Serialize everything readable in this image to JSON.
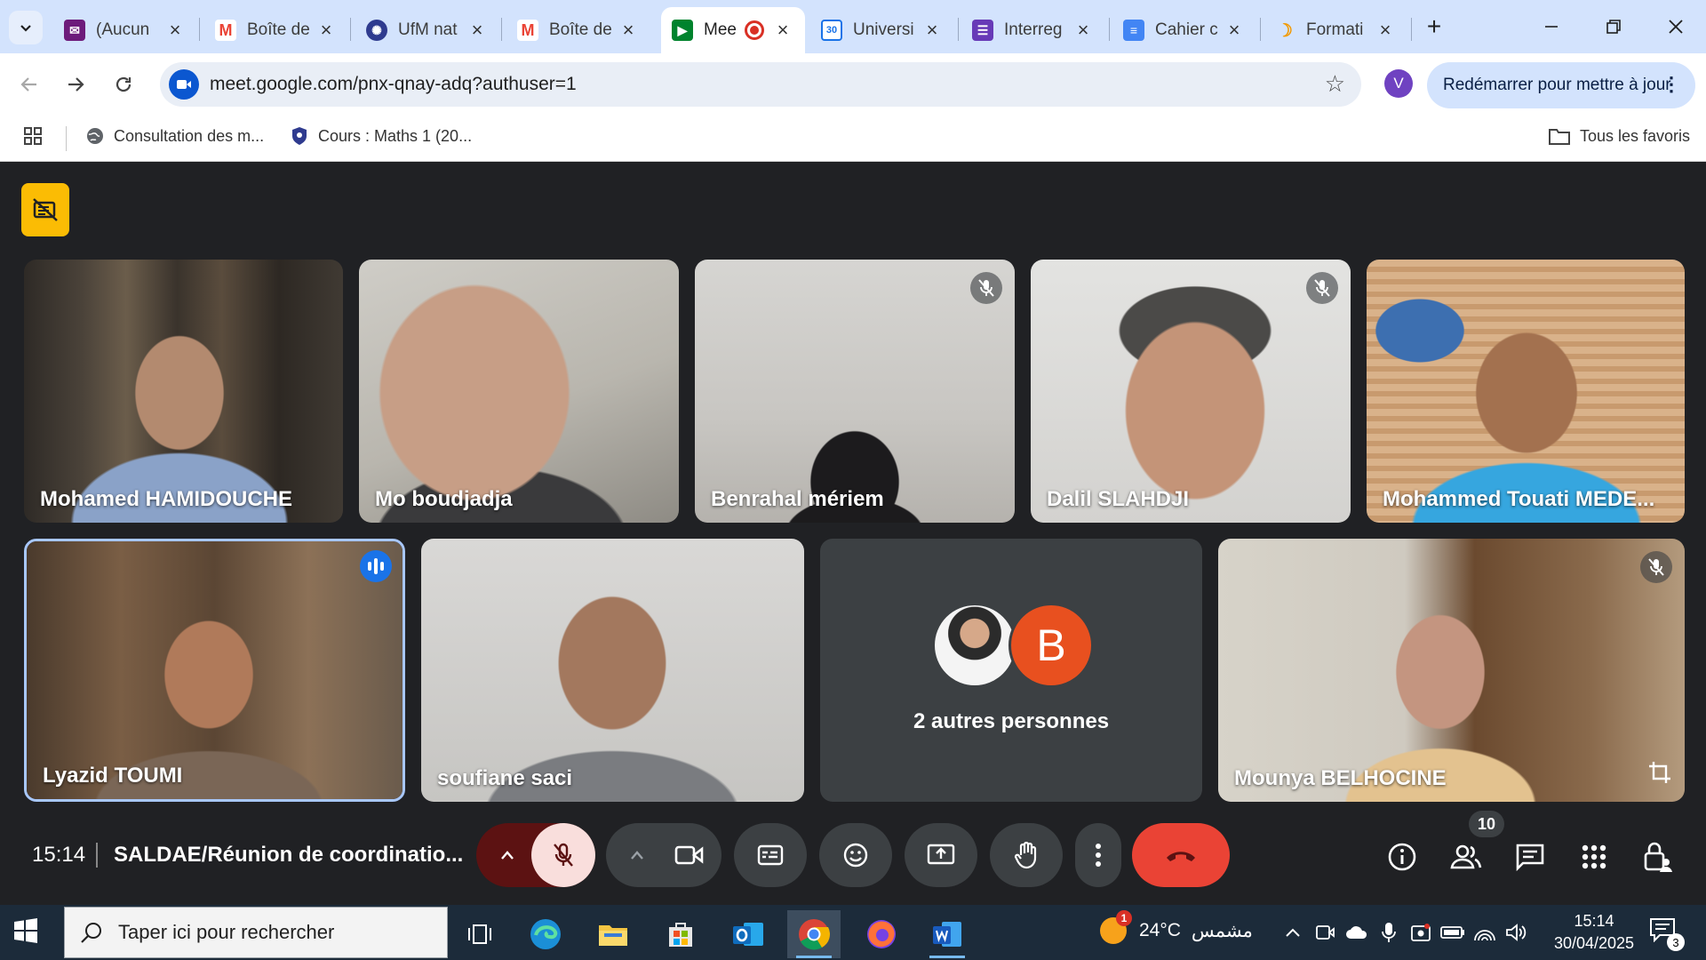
{
  "browser": {
    "tabs": [
      {
        "title": "(Aucun",
        "favicon": "mail-icon",
        "color": "#6d1b7b"
      },
      {
        "title": "Boîte de",
        "favicon": "gmail-icon",
        "color": "#ea4335"
      },
      {
        "title": "UfM nat",
        "favicon": "ufm-icon",
        "color": "#2f3b8f"
      },
      {
        "title": "Boîte de",
        "favicon": "gmail-icon",
        "color": "#ea4335"
      },
      {
        "title": "Mee",
        "favicon": "google-meet-icon",
        "color": "#00832d",
        "active": true,
        "recording": true
      },
      {
        "title": "Universi",
        "favicon": "google-calendar-icon",
        "color": "#1a73e8"
      },
      {
        "title": "Interreg",
        "favicon": "google-forms-icon",
        "color": "#673ab7"
      },
      {
        "title": "Cahier c",
        "favicon": "google-docs-icon",
        "color": "#4285f4"
      },
      {
        "title": "Formati",
        "favicon": "moon-icon",
        "color": "#f29900"
      }
    ],
    "url": "meet.google.com/pnx-qnay-adq?authuser=1",
    "profile_initial": "V",
    "restart_label": "Redémarrer pour mettre à jour",
    "bookmarks": [
      {
        "label": "Consultation des m...",
        "icon": "globe-icon"
      },
      {
        "label": "Cours : Maths 1 (20...",
        "icon": "shield-icon"
      }
    ],
    "all_bookmarks_label": "Tous les favoris"
  },
  "meet": {
    "participants_row1": [
      {
        "name": "Mohamed HAMIDOUCHE",
        "muted": false
      },
      {
        "name": "Mo boudjadja",
        "muted": false
      },
      {
        "name": "Benrahal mériem",
        "muted": true
      },
      {
        "name": "Dalil SLAHDJI",
        "muted": true
      },
      {
        "name": "Mohammed Touati MEDE...",
        "muted": false
      }
    ],
    "participants_row2": [
      {
        "name": "Lyazid TOUMI",
        "speaking": true
      },
      {
        "name": "soufiane saci"
      },
      {
        "name": "Mounya BELHOCINE",
        "muted": true
      }
    ],
    "others": {
      "label": "2 autres personnes",
      "avatar_initial": "B",
      "avatar_color": "#e8501f"
    },
    "time": "15:14",
    "meeting_title": "SALDAE/Réunion de coordinatio...",
    "participant_count": "10",
    "colors": {
      "hangup": "#ea4335",
      "mic_off_bg": "#f9dedc",
      "speaking_border": "#a8c7fa",
      "recording_badge": "#fbbc04"
    }
  },
  "taskbar": {
    "search_placeholder": "Taper ici pour rechercher",
    "weather": {
      "temp": "24°C",
      "condition": "مشمس",
      "badge": "1"
    },
    "clock_time": "15:14",
    "clock_date": "30/04/2025",
    "notification_count": "3"
  }
}
